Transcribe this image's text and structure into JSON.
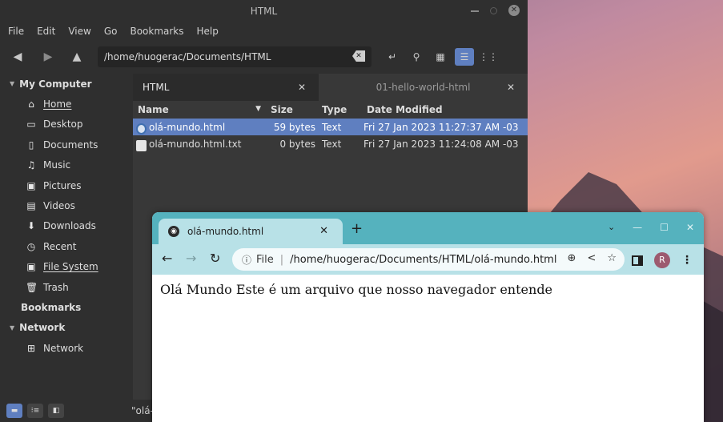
{
  "file_manager": {
    "title": "HTML",
    "menu": [
      "File",
      "Edit",
      "View",
      "Go",
      "Bookmarks",
      "Help"
    ],
    "path": "/home/huogerac/Documents/HTML",
    "sidebar": {
      "my_computer": "My Computer",
      "items": [
        {
          "label": "Home",
          "icon": "home-icon"
        },
        {
          "label": "Desktop",
          "icon": "desktop-icon"
        },
        {
          "label": "Documents",
          "icon": "documents-icon"
        },
        {
          "label": "Music",
          "icon": "music-icon"
        },
        {
          "label": "Pictures",
          "icon": "pictures-icon"
        },
        {
          "label": "Videos",
          "icon": "videos-icon"
        },
        {
          "label": "Downloads",
          "icon": "downloads-icon"
        },
        {
          "label": "Recent",
          "icon": "recent-icon"
        },
        {
          "label": "File System",
          "icon": "drive-icon"
        },
        {
          "label": "Trash",
          "icon": "trash-icon"
        }
      ],
      "bookmarks": "Bookmarks",
      "network_header": "Network",
      "network_item": "Network"
    },
    "tabs": [
      {
        "label": "HTML",
        "active": true
      },
      {
        "label": "01-hello-world-html",
        "active": false
      }
    ],
    "columns": {
      "name": "Name",
      "size": "Size",
      "type": "Type",
      "date": "Date Modified"
    },
    "files": [
      {
        "name": "olá-mundo.html",
        "size": "59 bytes",
        "type": "Text",
        "date": "Fri 27 Jan 2023 11:27:37 AM -03",
        "selected": true
      },
      {
        "name": "olá-mundo.html.txt",
        "size": "0 bytes",
        "type": "Text",
        "date": "Fri 27 Jan 2023 11:24:08 AM -03",
        "selected": false
      }
    ],
    "status_text": "\"olá-"
  },
  "browser": {
    "tab_title": "olá-mundo.html",
    "omnibox": {
      "scheme_label": "File",
      "path": "/home/huogerac/Documents/HTML/olá-mundo.html"
    },
    "avatar_letter": "R",
    "page_text": "Olá Mundo Este é um arquivo que nosso navegador entende"
  }
}
